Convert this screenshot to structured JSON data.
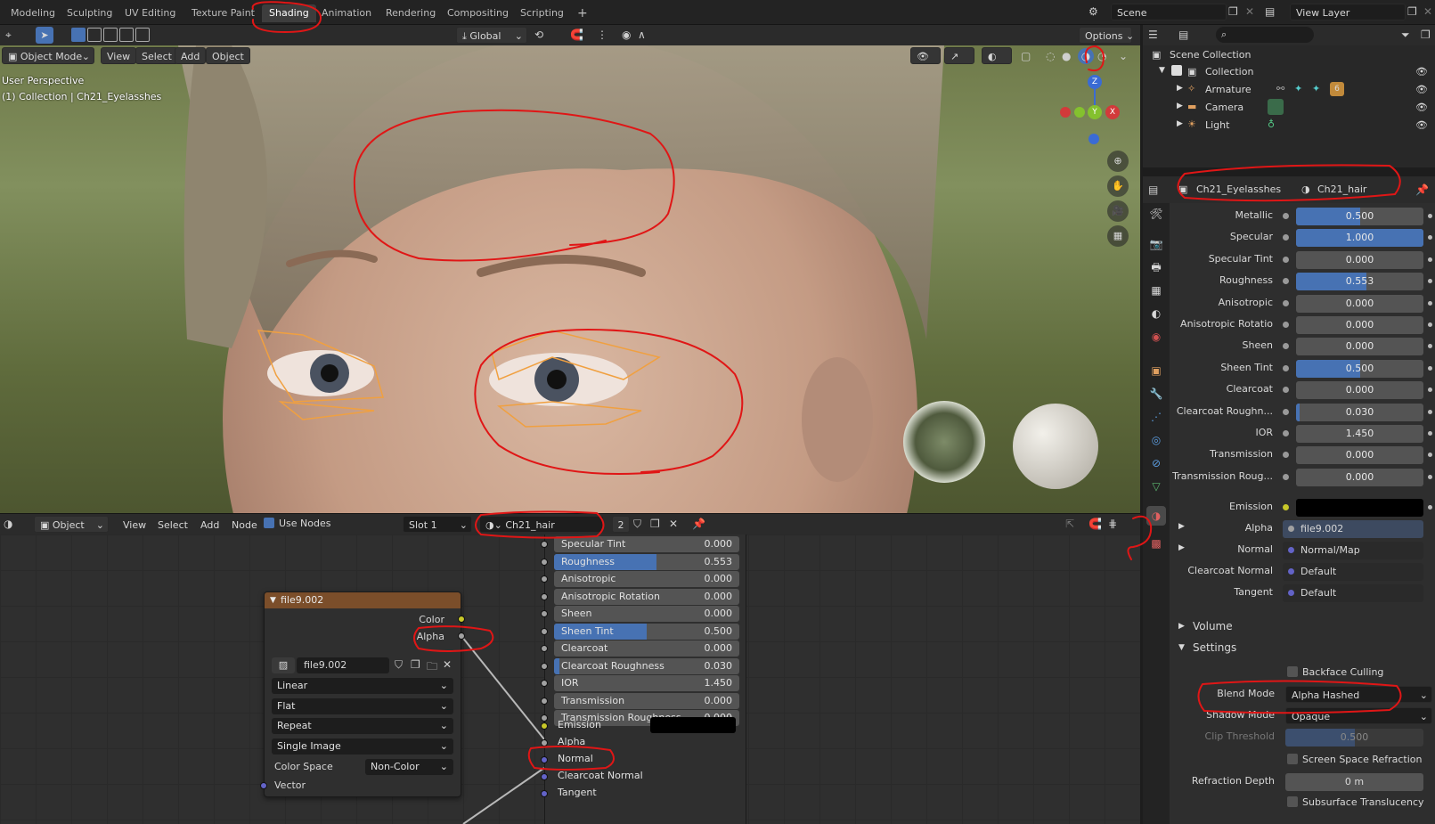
{
  "topbar": {
    "workspaces": [
      "Modeling",
      "Sculpting",
      "UV Editing",
      "Texture Paint",
      "Shading",
      "Animation",
      "Rendering",
      "Compositing",
      "Scripting"
    ],
    "active_workspace": "Shading",
    "add_tab": "+",
    "scene_label": "Scene",
    "view_layer_label": "View Layer"
  },
  "viewport_header": {
    "transform_orientation": "Global",
    "options_label": "Options",
    "mode": "Object Mode",
    "menus": [
      "View",
      "Select",
      "Add",
      "Object"
    ]
  },
  "viewport": {
    "perspective_text": "User Perspective",
    "collection_text": "(1) Collection | Ch21_Eyelasshes",
    "gizmo": {
      "z": "Z",
      "y": "Y",
      "x": "X"
    }
  },
  "node_header": {
    "editor": "Object",
    "menus": [
      "View",
      "Select",
      "Add",
      "Node"
    ],
    "use_nodes_label": "Use Nodes",
    "slot": "Slot 1",
    "material": "Ch21_hair",
    "users": "2"
  },
  "image_node": {
    "title": "file9.002",
    "outputs": [
      "Color",
      "Alpha"
    ],
    "image_name": "file9.002",
    "interpolation": "Linear",
    "projection": "Flat",
    "extension": "Repeat",
    "source": "Single Image",
    "color_space_label": "Color Space",
    "color_space": "Non-Color",
    "vector_label": "Vector"
  },
  "bsdf_node": {
    "rows": [
      {
        "label": "Specular Tint",
        "value": "0.000",
        "fill": 0
      },
      {
        "label": "Roughness",
        "value": "0.553",
        "fill": 0.553
      },
      {
        "label": "Anisotropic",
        "value": "0.000",
        "fill": 0
      },
      {
        "label": "Anisotropic Rotation",
        "value": "0.000",
        "fill": 0
      },
      {
        "label": "Sheen",
        "value": "0.000",
        "fill": 0
      },
      {
        "label": "Sheen Tint",
        "value": "0.500",
        "fill": 0.5
      },
      {
        "label": "Clearcoat",
        "value": "0.000",
        "fill": 0
      },
      {
        "label": "Clearcoat Roughness",
        "value": "0.030",
        "fill": 0.03
      },
      {
        "label": "IOR",
        "value": "1.450",
        "fill": 0
      },
      {
        "label": "Transmission",
        "value": "0.000",
        "fill": 0
      },
      {
        "label": "Transmission Roughness",
        "value": "0.000",
        "fill": 0
      }
    ],
    "emission_label": "Emission",
    "inputs": [
      "Alpha",
      "Normal",
      "Clearcoat Normal",
      "Tangent"
    ]
  },
  "outliner": {
    "root": "Scene Collection",
    "collection": "Collection",
    "items": [
      "Armature",
      "Camera",
      "Light"
    ],
    "armature_badge": "6"
  },
  "properties": {
    "object_name": "Ch21_Eyelasshes",
    "material_name": "Ch21_hair",
    "rows": [
      {
        "label": "Metallic",
        "value": "0.500",
        "fill": 0.5
      },
      {
        "label": "Specular",
        "value": "1.000",
        "fill": 1
      },
      {
        "label": "Specular Tint",
        "value": "0.000",
        "fill": 0
      },
      {
        "label": "Roughness",
        "value": "0.553",
        "fill": 0.553
      },
      {
        "label": "Anisotropic",
        "value": "0.000",
        "fill": 0
      },
      {
        "label": "Anisotropic Rotatio",
        "value": "0.000",
        "fill": 0
      },
      {
        "label": "Sheen",
        "value": "0.000",
        "fill": 0
      },
      {
        "label": "Sheen Tint",
        "value": "0.500",
        "fill": 0.5
      },
      {
        "label": "Clearcoat",
        "value": "0.000",
        "fill": 0
      },
      {
        "label": "Clearcoat Roughn...",
        "value": "0.030",
        "fill": 0.03
      },
      {
        "label": "IOR",
        "value": "1.450",
        "fill": 0
      },
      {
        "label": "Transmission",
        "value": "0.000",
        "fill": 0
      },
      {
        "label": "Transmission Roug...",
        "value": "0.000",
        "fill": 0
      }
    ],
    "emission_label": "Emission",
    "links": [
      {
        "label": "Alpha",
        "value": "file9.002"
      },
      {
        "label": "Normal",
        "value": "Normal/Map"
      },
      {
        "label": "Clearcoat Normal",
        "value": "Default"
      },
      {
        "label": "Tangent",
        "value": "Default"
      }
    ],
    "volume_label": "Volume",
    "settings_label": "Settings",
    "backface_culling": "Backface Culling",
    "blend_mode_label": "Blend Mode",
    "blend_mode": "Alpha Hashed",
    "shadow_mode_label": "Shadow Mode",
    "shadow_mode": "Opaque",
    "clip_threshold_label": "Clip Threshold",
    "clip_threshold": "0.500",
    "screen_space_refraction": "Screen Space Refraction",
    "refraction_depth_label": "Refraction Depth",
    "refraction_depth": "0 m",
    "subsurface_translucency": "Subsurface Translucency"
  },
  "colors": {
    "accent": "#4772b3",
    "node_header": "#7b4e2a",
    "annotation": "#e01616",
    "selection_outline": "#f0a040"
  }
}
